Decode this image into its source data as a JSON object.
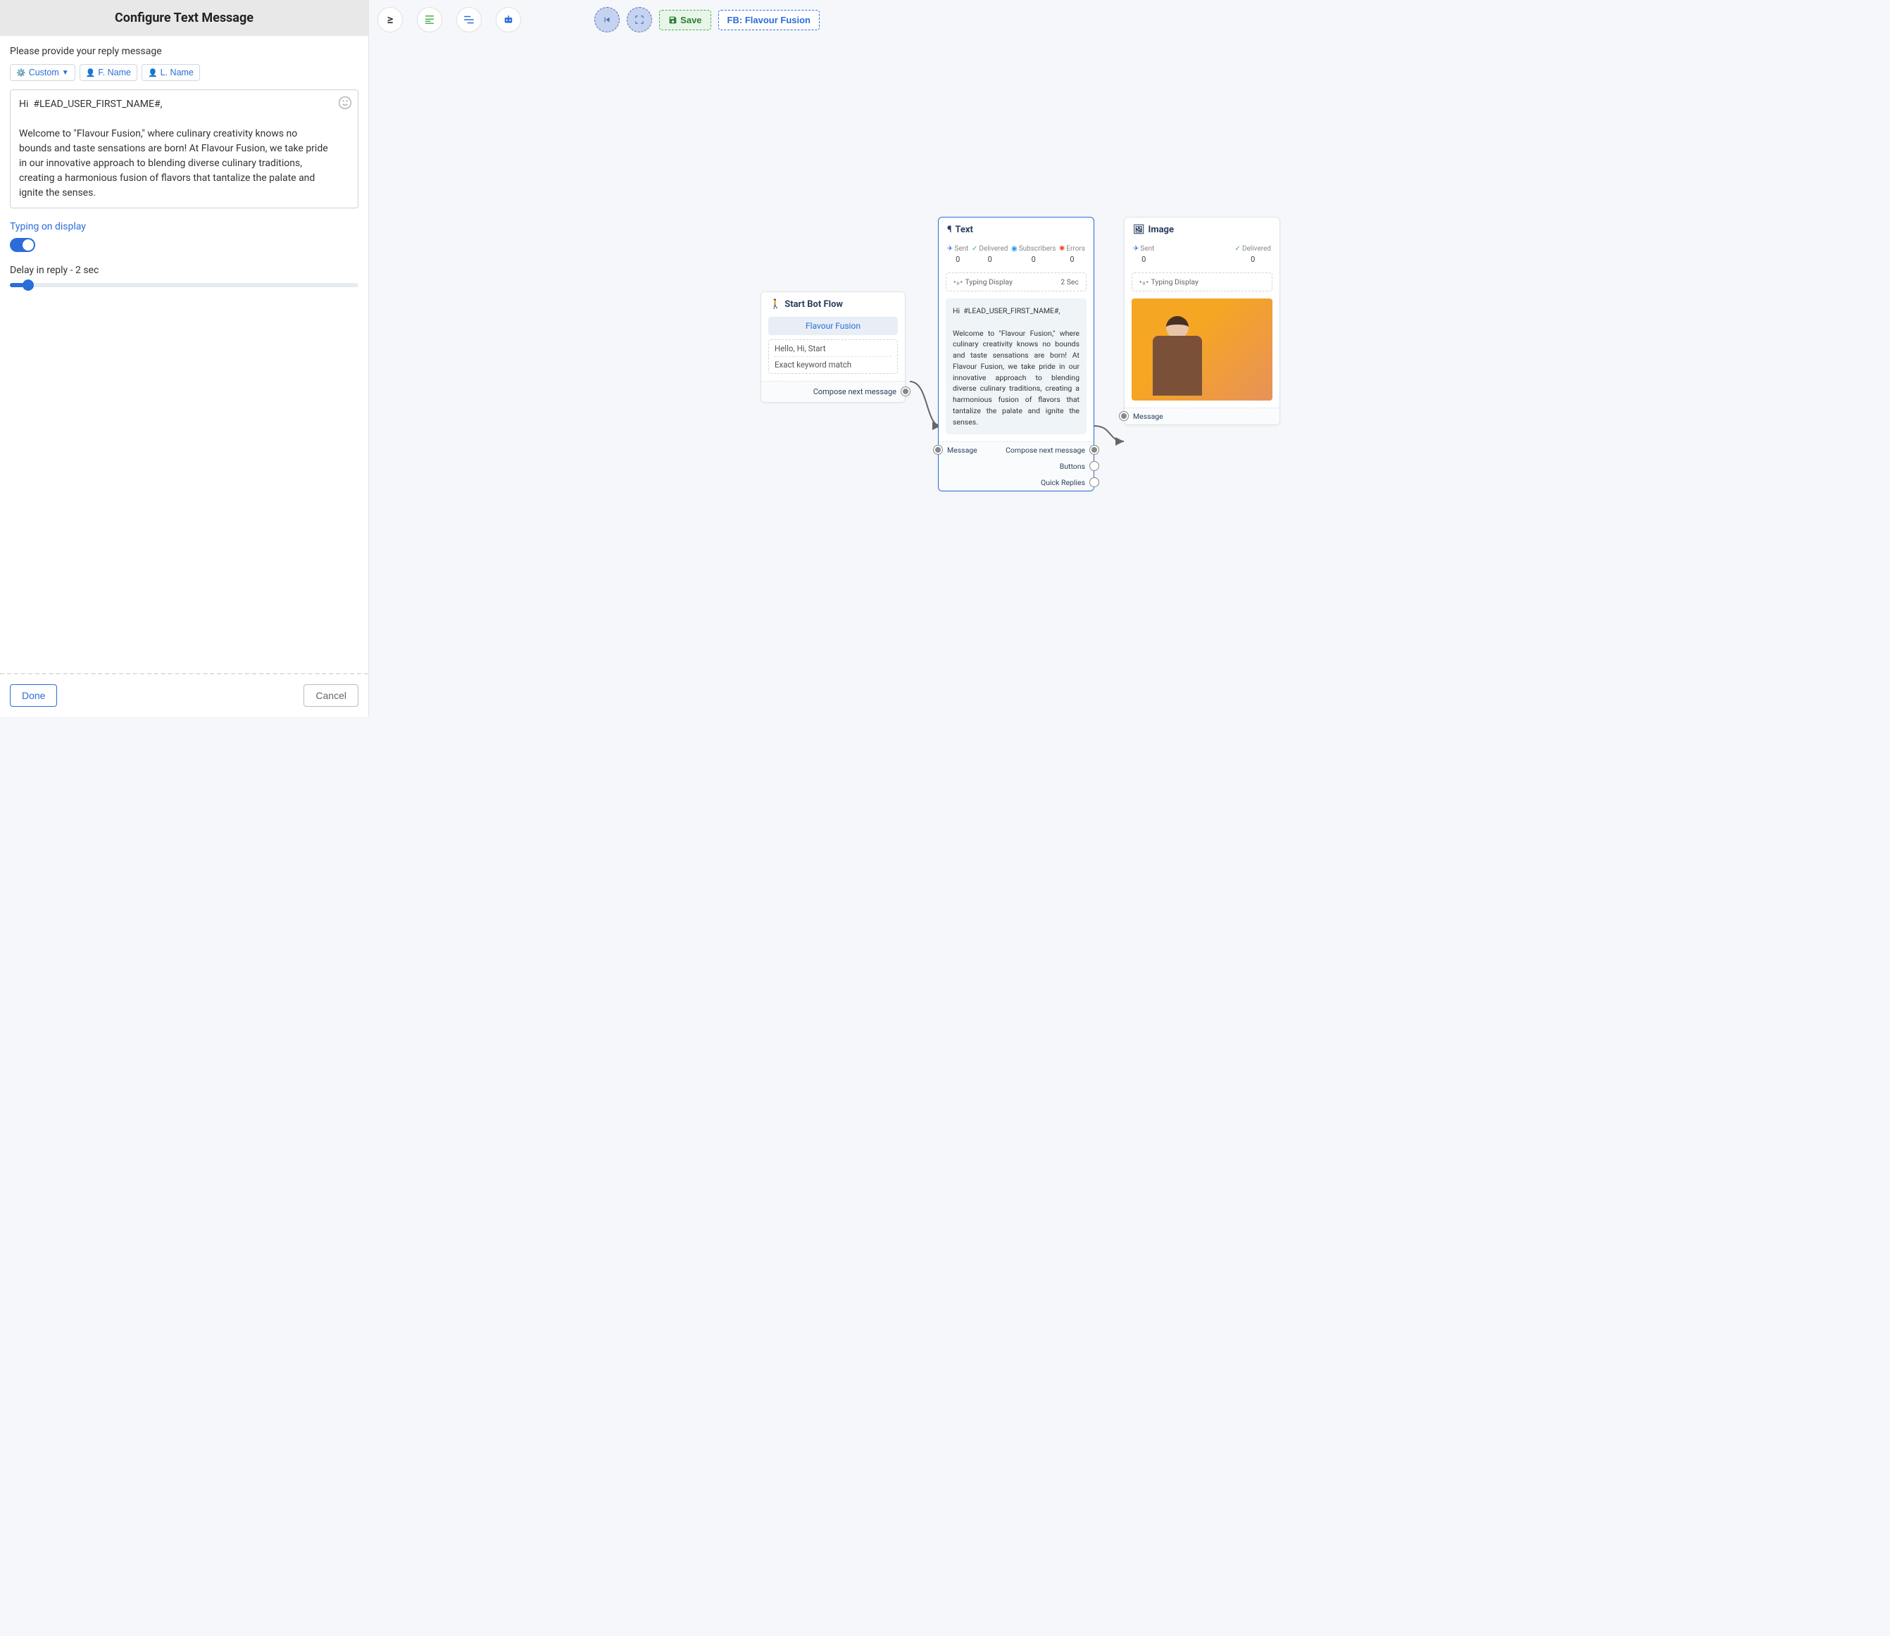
{
  "panel": {
    "title": "Configure Text Message",
    "prompt": "Please provide your reply message",
    "tokens": {
      "custom": "Custom",
      "fname": "F. Name",
      "lname": "L. Name"
    },
    "message_text": "Hi  #LEAD_USER_FIRST_NAME#,\n\nWelcome to \"Flavour Fusion,\" where culinary creativity knows no bounds and taste sensations are born! At Flavour Fusion, we take pride in our innovative approach to blending diverse culinary traditions, creating a harmonious fusion of flavors that tantalize the palate and ignite the senses.",
    "typing_label": "Typing on display",
    "typing_on": true,
    "delay_label": "Delay in reply   -   2 sec",
    "delay_seconds": 2,
    "done": "Done",
    "cancel": "Cancel"
  },
  "toolbar": {
    "save": "Save",
    "account": "FB: Flavour Fusion"
  },
  "flow": {
    "start": {
      "title": "Start Bot Flow",
      "chip": "Flavour Fusion",
      "keywords": "Hello, Hi, Start",
      "match_type": "Exact keyword match",
      "out_label": "Compose next message"
    },
    "text_node": {
      "title": "Text",
      "stats": {
        "sent_label": "Sent",
        "sent_val": "0",
        "delivered_label": "Delivered",
        "delivered_val": "0",
        "subscribers_label": "Subscribers",
        "subscribers_val": "0",
        "errors_label": "Errors",
        "errors_val": "0"
      },
      "typing_display": "Typing Display",
      "typing_time": "2 Sec",
      "preview": "Hi  #LEAD_USER_FIRST_NAME#,\n\nWelcome to \"Flavour Fusion,\" where culinary creativity knows no bounds and taste sensations are born! At Flavour Fusion, we take pride in our innovative approach to blending diverse culinary traditions, creating a harmonious fusion of flavors that tantalize the palate and ignite the senses.",
      "link_message": "Message",
      "link_compose": "Compose next message",
      "link_buttons": "Buttons",
      "link_quick": "Quick Replies"
    },
    "image_node": {
      "title": "Image",
      "sent_label": "Sent",
      "sent_val": "0",
      "delivered_label": "Delivered",
      "delivered_val": "0",
      "typing_display": "Typing Display",
      "link_message": "Message"
    }
  }
}
